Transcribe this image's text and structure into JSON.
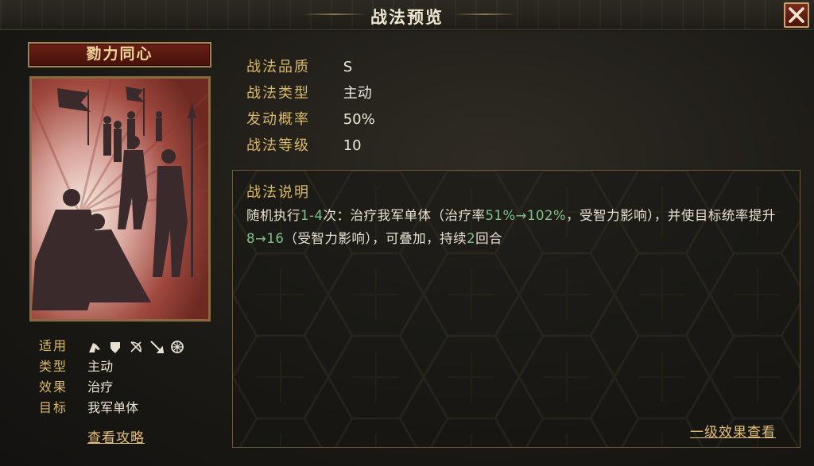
{
  "header": {
    "title": "战法预览",
    "close_label": "关闭"
  },
  "skill": {
    "name": "勠力同心",
    "attrs": [
      {
        "key": "适用",
        "troops": [
          "cavalry-icon",
          "shield-icon",
          "bow-icon",
          "spear-icon",
          "chariot-icon"
        ]
      },
      {
        "key": "类型",
        "value": "主动"
      },
      {
        "key": "效果",
        "value": "治疗"
      },
      {
        "key": "目标",
        "value": "我军单体"
      }
    ],
    "guide_link": "查看攻略"
  },
  "stats": [
    {
      "key": "战法品质",
      "value": "S"
    },
    {
      "key": "战法类型",
      "value": "主动"
    },
    {
      "key": "发动概率",
      "value": "50%"
    },
    {
      "key": "战法等级",
      "value": "10"
    }
  ],
  "description": {
    "title": "战法说明",
    "segments": [
      {
        "text": "随机执行",
        "green": false
      },
      {
        "text": "1-4",
        "green": true
      },
      {
        "text": "次：治疗我军单体（治疗率",
        "green": false
      },
      {
        "text": "51%→102%",
        "green": true
      },
      {
        "text": "，受智力影响），并使目标统率提升",
        "green": false
      },
      {
        "text": "8→16",
        "green": true
      },
      {
        "text": "（受智力影响），可叠加，持续",
        "green": false
      },
      {
        "text": "2",
        "green": true
      },
      {
        "text": "回合",
        "green": false
      }
    ],
    "level_link": "一级效果查看"
  },
  "colors": {
    "gold": "#d9b96a",
    "green": "#7fc28a",
    "plate_red": "#6a1f14",
    "card_red": "#7b3b33"
  }
}
